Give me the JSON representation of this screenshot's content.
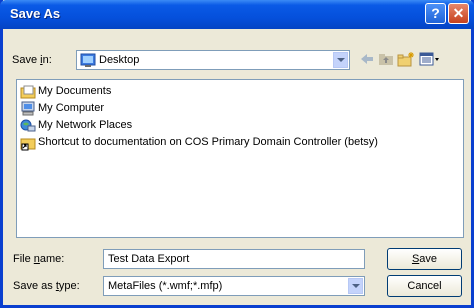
{
  "title": "Save As",
  "title_buttons": {
    "help": "?",
    "close": "✕"
  },
  "save_in": {
    "label_pre": "Save ",
    "label_key": "i",
    "label_post": "n:",
    "value": "Desktop"
  },
  "toolbar": {
    "back_icon": "back-arrow-icon",
    "up_icon": "up-folder-icon",
    "newfolder_icon": "new-folder-icon",
    "views_icon": "views-menu-icon"
  },
  "items": [
    {
      "label": "My Documents",
      "icon": "my-documents-icon"
    },
    {
      "label": "My Computer",
      "icon": "my-computer-icon"
    },
    {
      "label": "My Network Places",
      "icon": "network-places-icon"
    },
    {
      "label": "Shortcut to documentation on COS Primary Domain Controller (betsy)",
      "icon": "shortcut-folder-icon"
    }
  ],
  "file_name": {
    "label_pre": "File ",
    "label_key": "n",
    "label_post": "ame:",
    "value": "Test Data Export"
  },
  "save_as_type": {
    "label_pre": "Save as ",
    "label_key": "t",
    "label_post": "ype:",
    "value": "MetaFiles (*.wmf;*.mfp)"
  },
  "buttons": {
    "save_key": "S",
    "save_rest": "ave",
    "cancel": "Cancel"
  },
  "colors": {
    "titlebar": "#0550dc",
    "dialog_bg": "#ece9d8",
    "border": "#7f9db9"
  }
}
